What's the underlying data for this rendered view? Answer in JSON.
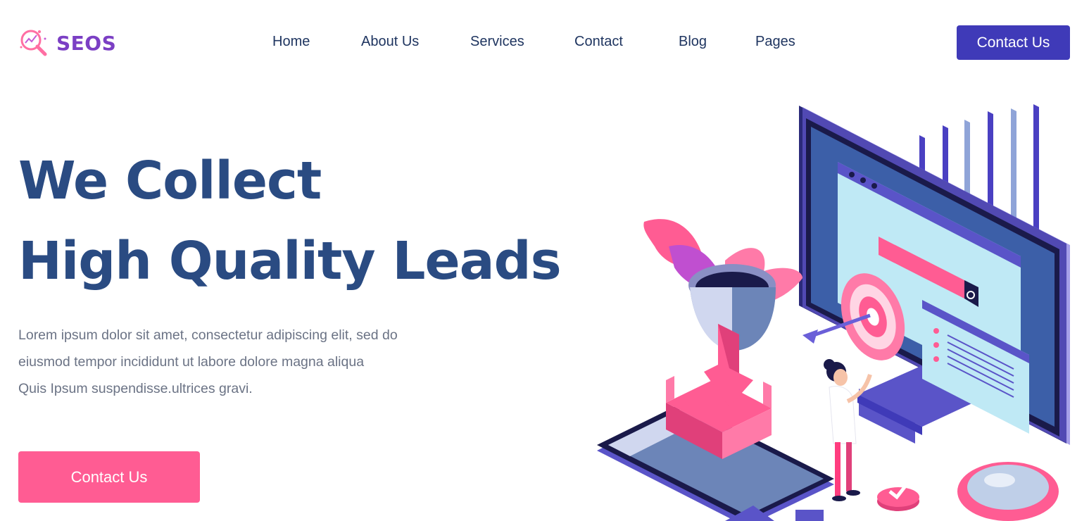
{
  "brand": {
    "name": "SEOS",
    "icon": "magnifier-chart-icon"
  },
  "nav": {
    "items": [
      {
        "label": "Home"
      },
      {
        "label": "About Us"
      },
      {
        "label": "Services"
      },
      {
        "label": "Contact"
      },
      {
        "label": "Blog"
      },
      {
        "label": "Pages"
      }
    ]
  },
  "header": {
    "cta_label": "Contact Us"
  },
  "hero": {
    "title_line1": "We Collect",
    "title_line2": "High Quality Leads",
    "desc_line1": "Lorem ipsum dolor sit amet, consectetur adipiscing elit, sed do",
    "desc_line2": "eiusmod tempor incididunt ut labore dolore magna aliqua",
    "desc_line3": "Quis Ipsum suspendisse.ultrices gravi.",
    "cta_label": "Contact Us"
  },
  "colors": {
    "primary": "#3f3ab8",
    "accent": "#ff5c93",
    "heading": "#2a4b82",
    "nav_text": "#1f3560",
    "body_text": "#6b7385",
    "logo": "#7b3fc4"
  }
}
